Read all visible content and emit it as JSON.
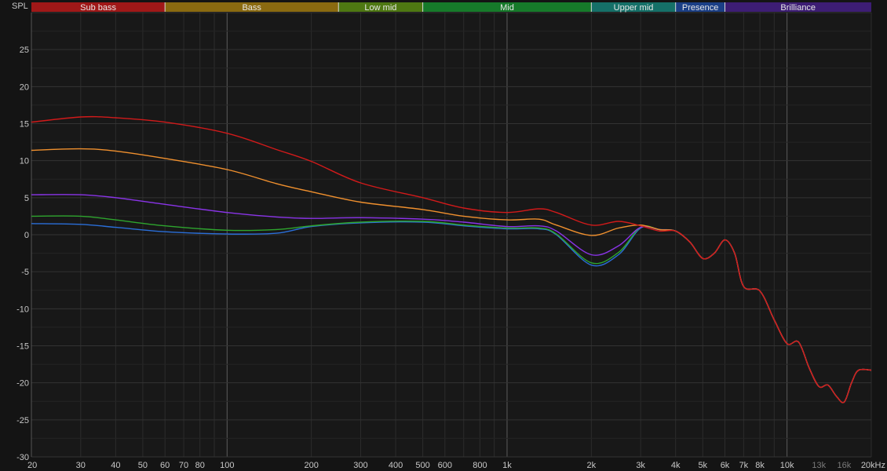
{
  "chart_data": {
    "type": "line",
    "ylabel": "SPL",
    "xscale": "log",
    "xlim": [
      20,
      20000
    ],
    "ylim": [
      -30,
      30
    ],
    "grid": true,
    "bands": [
      {
        "label": "Sub bass",
        "from": 20,
        "to": 60,
        "color": "#a01818"
      },
      {
        "label": "Bass",
        "from": 60,
        "to": 250,
        "color": "#8a6a10"
      },
      {
        "label": "Low mid",
        "from": 250,
        "to": 500,
        "color": "#4e7812"
      },
      {
        "label": "Mid",
        "from": 500,
        "to": 2000,
        "color": "#167a2a"
      },
      {
        "label": "Upper mid",
        "from": 2000,
        "to": 4000,
        "color": "#157068"
      },
      {
        "label": "Presence",
        "from": 4000,
        "to": 6000,
        "color": "#1b3f86"
      },
      {
        "label": "Brilliance",
        "from": 6000,
        "to": 20000,
        "color": "#3d1d74"
      }
    ],
    "y_ticks": [
      25,
      20,
      15,
      10,
      5,
      0,
      -5,
      -10,
      -15,
      -20,
      -25,
      -30
    ],
    "x_ticks": [
      {
        "value": 20,
        "label": "20"
      },
      {
        "value": 30,
        "label": "30"
      },
      {
        "value": 40,
        "label": "40"
      },
      {
        "value": 50,
        "label": "50"
      },
      {
        "value": 60,
        "label": "60"
      },
      {
        "value": 70,
        "label": "70"
      },
      {
        "value": 80,
        "label": "80"
      },
      {
        "value": 100,
        "label": "100"
      },
      {
        "value": 200,
        "label": "200"
      },
      {
        "value": 300,
        "label": "300"
      },
      {
        "value": 400,
        "label": "400"
      },
      {
        "value": 500,
        "label": "500"
      },
      {
        "value": 600,
        "label": "600"
      },
      {
        "value": 800,
        "label": "800"
      },
      {
        "value": 1000,
        "label": "1k"
      },
      {
        "value": 2000,
        "label": "2k"
      },
      {
        "value": 3000,
        "label": "3k"
      },
      {
        "value": 4000,
        "label": "4k"
      },
      {
        "value": 5000,
        "label": "5k"
      },
      {
        "value": 6000,
        "label": "6k"
      },
      {
        "value": 7000,
        "label": "7k"
      },
      {
        "value": 8000,
        "label": "8k"
      },
      {
        "value": 10000,
        "label": "10k"
      },
      {
        "value": 13000,
        "label": "13k",
        "dim": true
      },
      {
        "value": 16000,
        "label": "16k",
        "dim": true
      },
      {
        "value": 20000,
        "label": "20kHz"
      }
    ],
    "x": [
      20,
      30,
      40,
      60,
      100,
      150,
      200,
      300,
      500,
      700,
      1000,
      1300,
      1500,
      2000,
      2500,
      3000,
      3500,
      4000,
      4500,
      5000,
      5500,
      6000,
      6500,
      7000,
      8000,
      9000,
      10000,
      11000,
      12000,
      13000,
      14000,
      15000,
      16000,
      17000,
      18000,
      20000
    ],
    "tail": [
      0.8,
      0.5,
      -1.0,
      -3.2,
      -2.5,
      -0.7,
      -2.5,
      -7.0,
      -7.6,
      -11.5,
      -14.7,
      -14.5,
      -18.0,
      -20.5,
      -20.3,
      -21.8,
      -22.6,
      -20.0,
      -18.3,
      -18.3
    ],
    "series": [
      {
        "color": "#d11a1a",
        "values": [
          15.2,
          15.9,
          15.8,
          15.2,
          13.7,
          11.5,
          9.9,
          7.0,
          5.0,
          3.6,
          3.0,
          3.5,
          3.0,
          1.3,
          1.8,
          1.2,
          0.5
        ]
      },
      {
        "color": "#f0902e",
        "values": [
          11.4,
          11.6,
          11.3,
          10.3,
          8.8,
          6.9,
          5.8,
          4.4,
          3.4,
          2.5,
          2.0,
          2.1,
          1.3,
          -0.1,
          0.9,
          1.3,
          0.7
        ]
      },
      {
        "color": "#8a34e8",
        "values": [
          5.4,
          5.4,
          5.0,
          4.1,
          3.0,
          2.4,
          2.2,
          2.3,
          2.1,
          1.7,
          1.1,
          1.2,
          0.5,
          -2.7,
          -1.5,
          1.0,
          0.7
        ]
      },
      {
        "color": "#2ea52e",
        "values": [
          2.5,
          2.5,
          2.0,
          1.2,
          0.6,
          0.7,
          1.2,
          1.7,
          1.8,
          1.3,
          0.9,
          0.9,
          0.1,
          -3.8,
          -2.4,
          1.0,
          0.7
        ]
      },
      {
        "color": "#2a6ed8",
        "values": [
          1.5,
          1.4,
          1.0,
          0.4,
          0.1,
          0.2,
          1.1,
          1.6,
          1.7,
          1.2,
          0.8,
          0.8,
          0.0,
          -4.1,
          -2.7,
          0.9,
          0.7
        ]
      }
    ]
  }
}
